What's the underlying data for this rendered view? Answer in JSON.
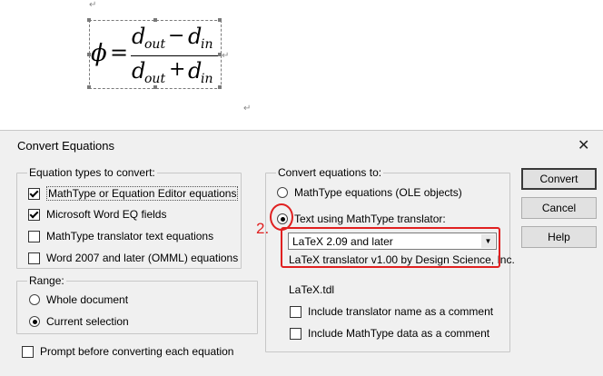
{
  "document": {
    "equation": {
      "lhs": "ϕ",
      "equals": "=",
      "numerator_main": "d",
      "numerator_sub1": "out",
      "minus": "−",
      "numerator_main2": "d",
      "numerator_sub2": "in",
      "denominator_main": "d",
      "denominator_sub1": "out",
      "plus": "+",
      "denominator_main2": "d",
      "denominator_sub2": "in"
    },
    "paragraph_mark": "↵"
  },
  "dialog": {
    "title": "Convert Equations",
    "close_glyph": "✕",
    "types_group": {
      "legend": "Equation types to convert:",
      "options": [
        {
          "label": "MathType or Equation Editor equations",
          "checked": true
        },
        {
          "label": "Microsoft Word EQ fields",
          "checked": true
        },
        {
          "label": "MathType translator text equations",
          "checked": false
        },
        {
          "label": "Word 2007 and later (OMML) equations",
          "checked": false
        }
      ]
    },
    "range_group": {
      "legend": "Range:",
      "options": [
        {
          "label": "Whole document",
          "selected": false
        },
        {
          "label": "Current selection",
          "selected": true
        }
      ]
    },
    "prompt_checkbox": {
      "label": "Prompt before converting each equation",
      "checked": false
    },
    "convert_to_group": {
      "legend": "Convert equations to:",
      "option_ole": "MathType equations (OLE objects)",
      "option_text": "Text using MathType translator:",
      "translator_selected": "LaTeX 2.09 and later",
      "translator_description": "LaTeX translator v1.00 by Design Science, Inc.",
      "tdl_file": "LaTeX.tdl",
      "include_name": {
        "label": "Include translator name as a comment",
        "checked": false
      },
      "include_data": {
        "label": "Include MathType data as a comment",
        "checked": false
      }
    },
    "buttons": {
      "convert": "Convert",
      "cancel": "Cancel",
      "help": "Help"
    },
    "annotation": {
      "step_label": "2.",
      "color": "#e02020"
    }
  }
}
